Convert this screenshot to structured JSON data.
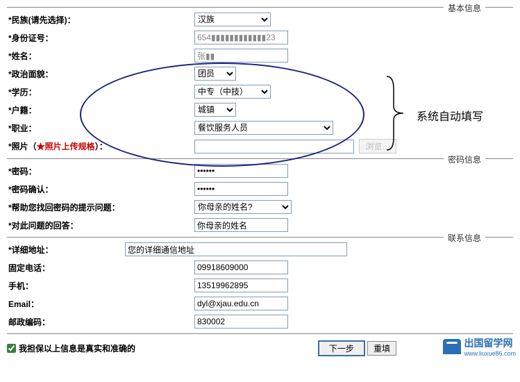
{
  "sections": {
    "basic": "基本信息",
    "password": "密码信息",
    "contact": "联系信息"
  },
  "labels": {
    "ethnicity": "*民族(请先选择)：",
    "id_number": "*身份证号：",
    "name": "*姓名：",
    "politics": "*政治面貌：",
    "education": "*学历：",
    "hukou": "*户籍：",
    "occupation": "*职业：",
    "photo_pre": "*照片（",
    "photo_red": "★照片上传规格",
    "photo_post": "）：",
    "password": "*密码：",
    "password_confirm": "*密码确认：",
    "hint_question": "*帮助您找回密码的提示问题：",
    "hint_answer": "*对此问题的回答：",
    "address": "*详细地址：",
    "landline": "固定电话：",
    "mobile": "手机：",
    "email": "Email：",
    "postcode": "邮政编码："
  },
  "values": {
    "ethnicity": "汉族",
    "id_number": "654▮▮▮▮▮▮▮▮▮▮▮▮23",
    "name": "张▮▮",
    "politics": "团员",
    "education": "中专（中技）",
    "hukou": "城镇",
    "occupation": "餐饮服务人员",
    "photo": "",
    "password": "••••••",
    "password_confirm": "••••••",
    "hint_question": "你母亲的姓名?",
    "hint_answer": "你母亲的姓名",
    "address": "您的详细通信地址",
    "landline": "09918609000",
    "mobile": "13519962895",
    "email": "dyl@xjau.edu.cn",
    "postcode": "830002"
  },
  "buttons": {
    "browse": "浏览…",
    "next": "下一步",
    "reset": "重填"
  },
  "confirm": {
    "label": "我担保以上信息是真实和准确的",
    "checked": true
  },
  "annotation": {
    "text": "系统自动填写"
  },
  "watermark": {
    "text": "出国留学网",
    "url": "www.liuxue86.com"
  }
}
